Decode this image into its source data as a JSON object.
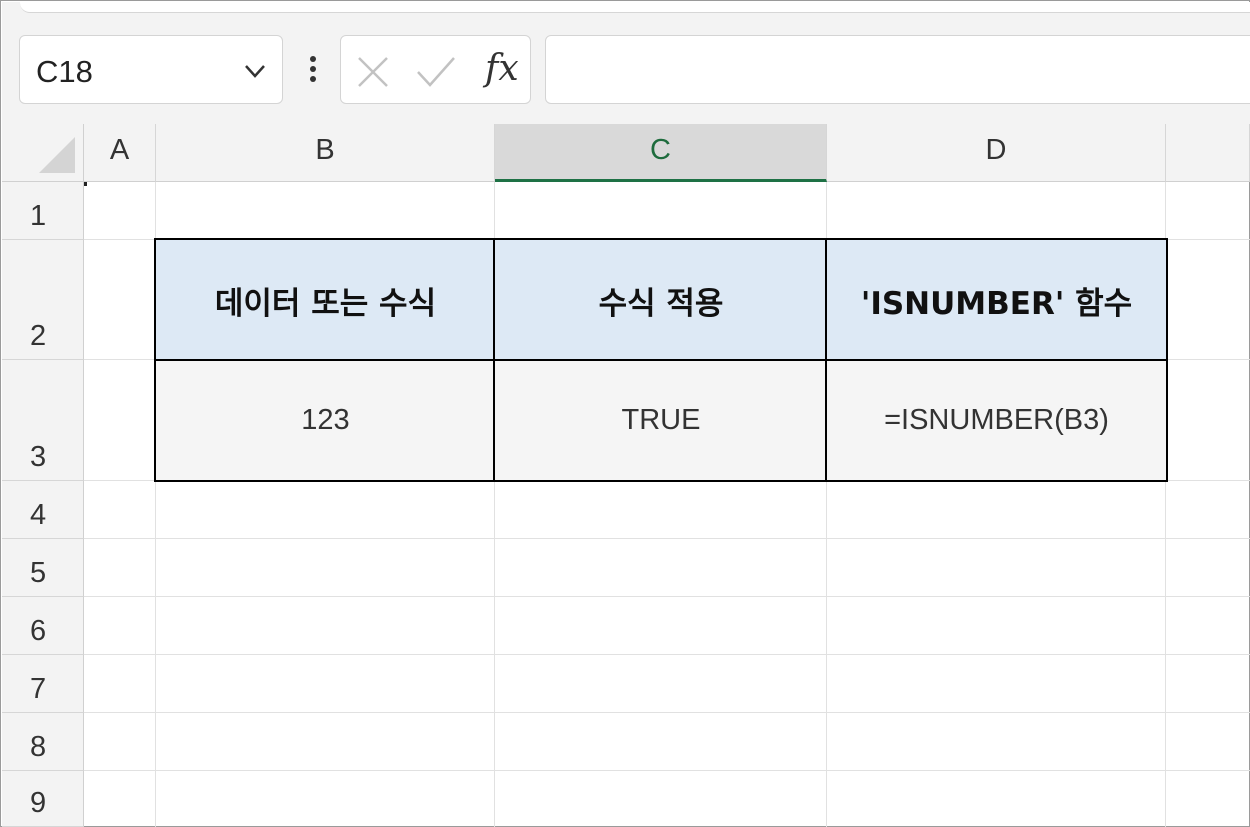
{
  "formula_bar": {
    "name_box": "C18",
    "formula": "",
    "icons": [
      "chevron-down-icon",
      "more-vertical-icon",
      "cancel-x-icon",
      "enter-check-icon",
      "function-fx-icon"
    ],
    "fx_label": "fx"
  },
  "grid": {
    "columns": [
      "A",
      "B",
      "C",
      "D"
    ],
    "selected_column": "C",
    "rows": [
      "1",
      "2",
      "3",
      "4",
      "5",
      "6",
      "7",
      "8",
      "9"
    ],
    "accent_color": "#1e7145"
  },
  "table": {
    "headers": [
      "데이터 또는 수식",
      "수식 적용",
      "'ISNUMBER' 함수"
    ],
    "row": [
      "123",
      "TRUE",
      "=ISNUMBER(B3)"
    ],
    "header_fill": "#dde9f5",
    "body_fill": "#f5f5f5"
  }
}
